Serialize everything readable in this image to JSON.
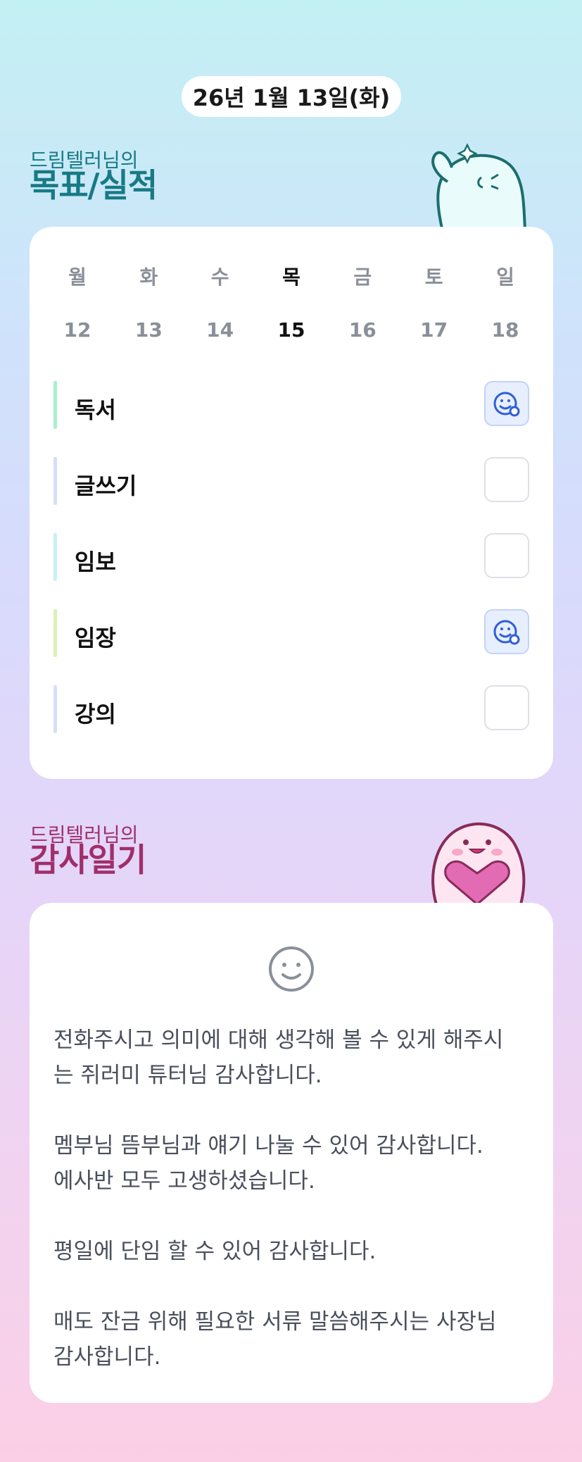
{
  "header": {
    "date": "26년 1월 13일(화)"
  },
  "goals_section": {
    "subtitle": "드림텔러님의",
    "title": "목표/실적",
    "weekdays": [
      {
        "day": "월",
        "date": "12"
      },
      {
        "day": "화",
        "date": "13"
      },
      {
        "day": "수",
        "date": "14"
      },
      {
        "day": "목",
        "date": "15"
      },
      {
        "day": "금",
        "date": "16"
      },
      {
        "day": "토",
        "date": "17"
      },
      {
        "day": "일",
        "date": "18"
      }
    ],
    "selected_day": "목",
    "items": [
      {
        "label": "독서",
        "checked": true,
        "color": "#a9efce"
      },
      {
        "label": "글쓰기",
        "checked": false,
        "color": "#d5dff8"
      },
      {
        "label": "임보",
        "checked": false,
        "color": "#c7f0f6"
      },
      {
        "label": "임장",
        "checked": true,
        "color": "#d8f3b2"
      },
      {
        "label": "강의",
        "checked": false,
        "color": "#d5dff8"
      }
    ]
  },
  "gratitude_section": {
    "subtitle": "드림텔러님의",
    "title": "감사일기",
    "text": "전화주시고 의미에 대해 생각해 볼 수 있게 해주시\n는 쥐러미 튜터님 감사합니다.\n\n멤부님 뜸부님과 얘기 나눌 수 있어 감사합니다.\n에사반 모두 고생하셨습니다.\n\n평일에 단임 할 수 있어 감사합니다.\n\n매도 잔금 위해 필요한 서류 말씀해주시는 사장님\n감사합니다."
  },
  "colors": {
    "goals_title": "#177a85",
    "gratitude_title": "#a02e6a",
    "check_icon": "#2f5fd6"
  }
}
